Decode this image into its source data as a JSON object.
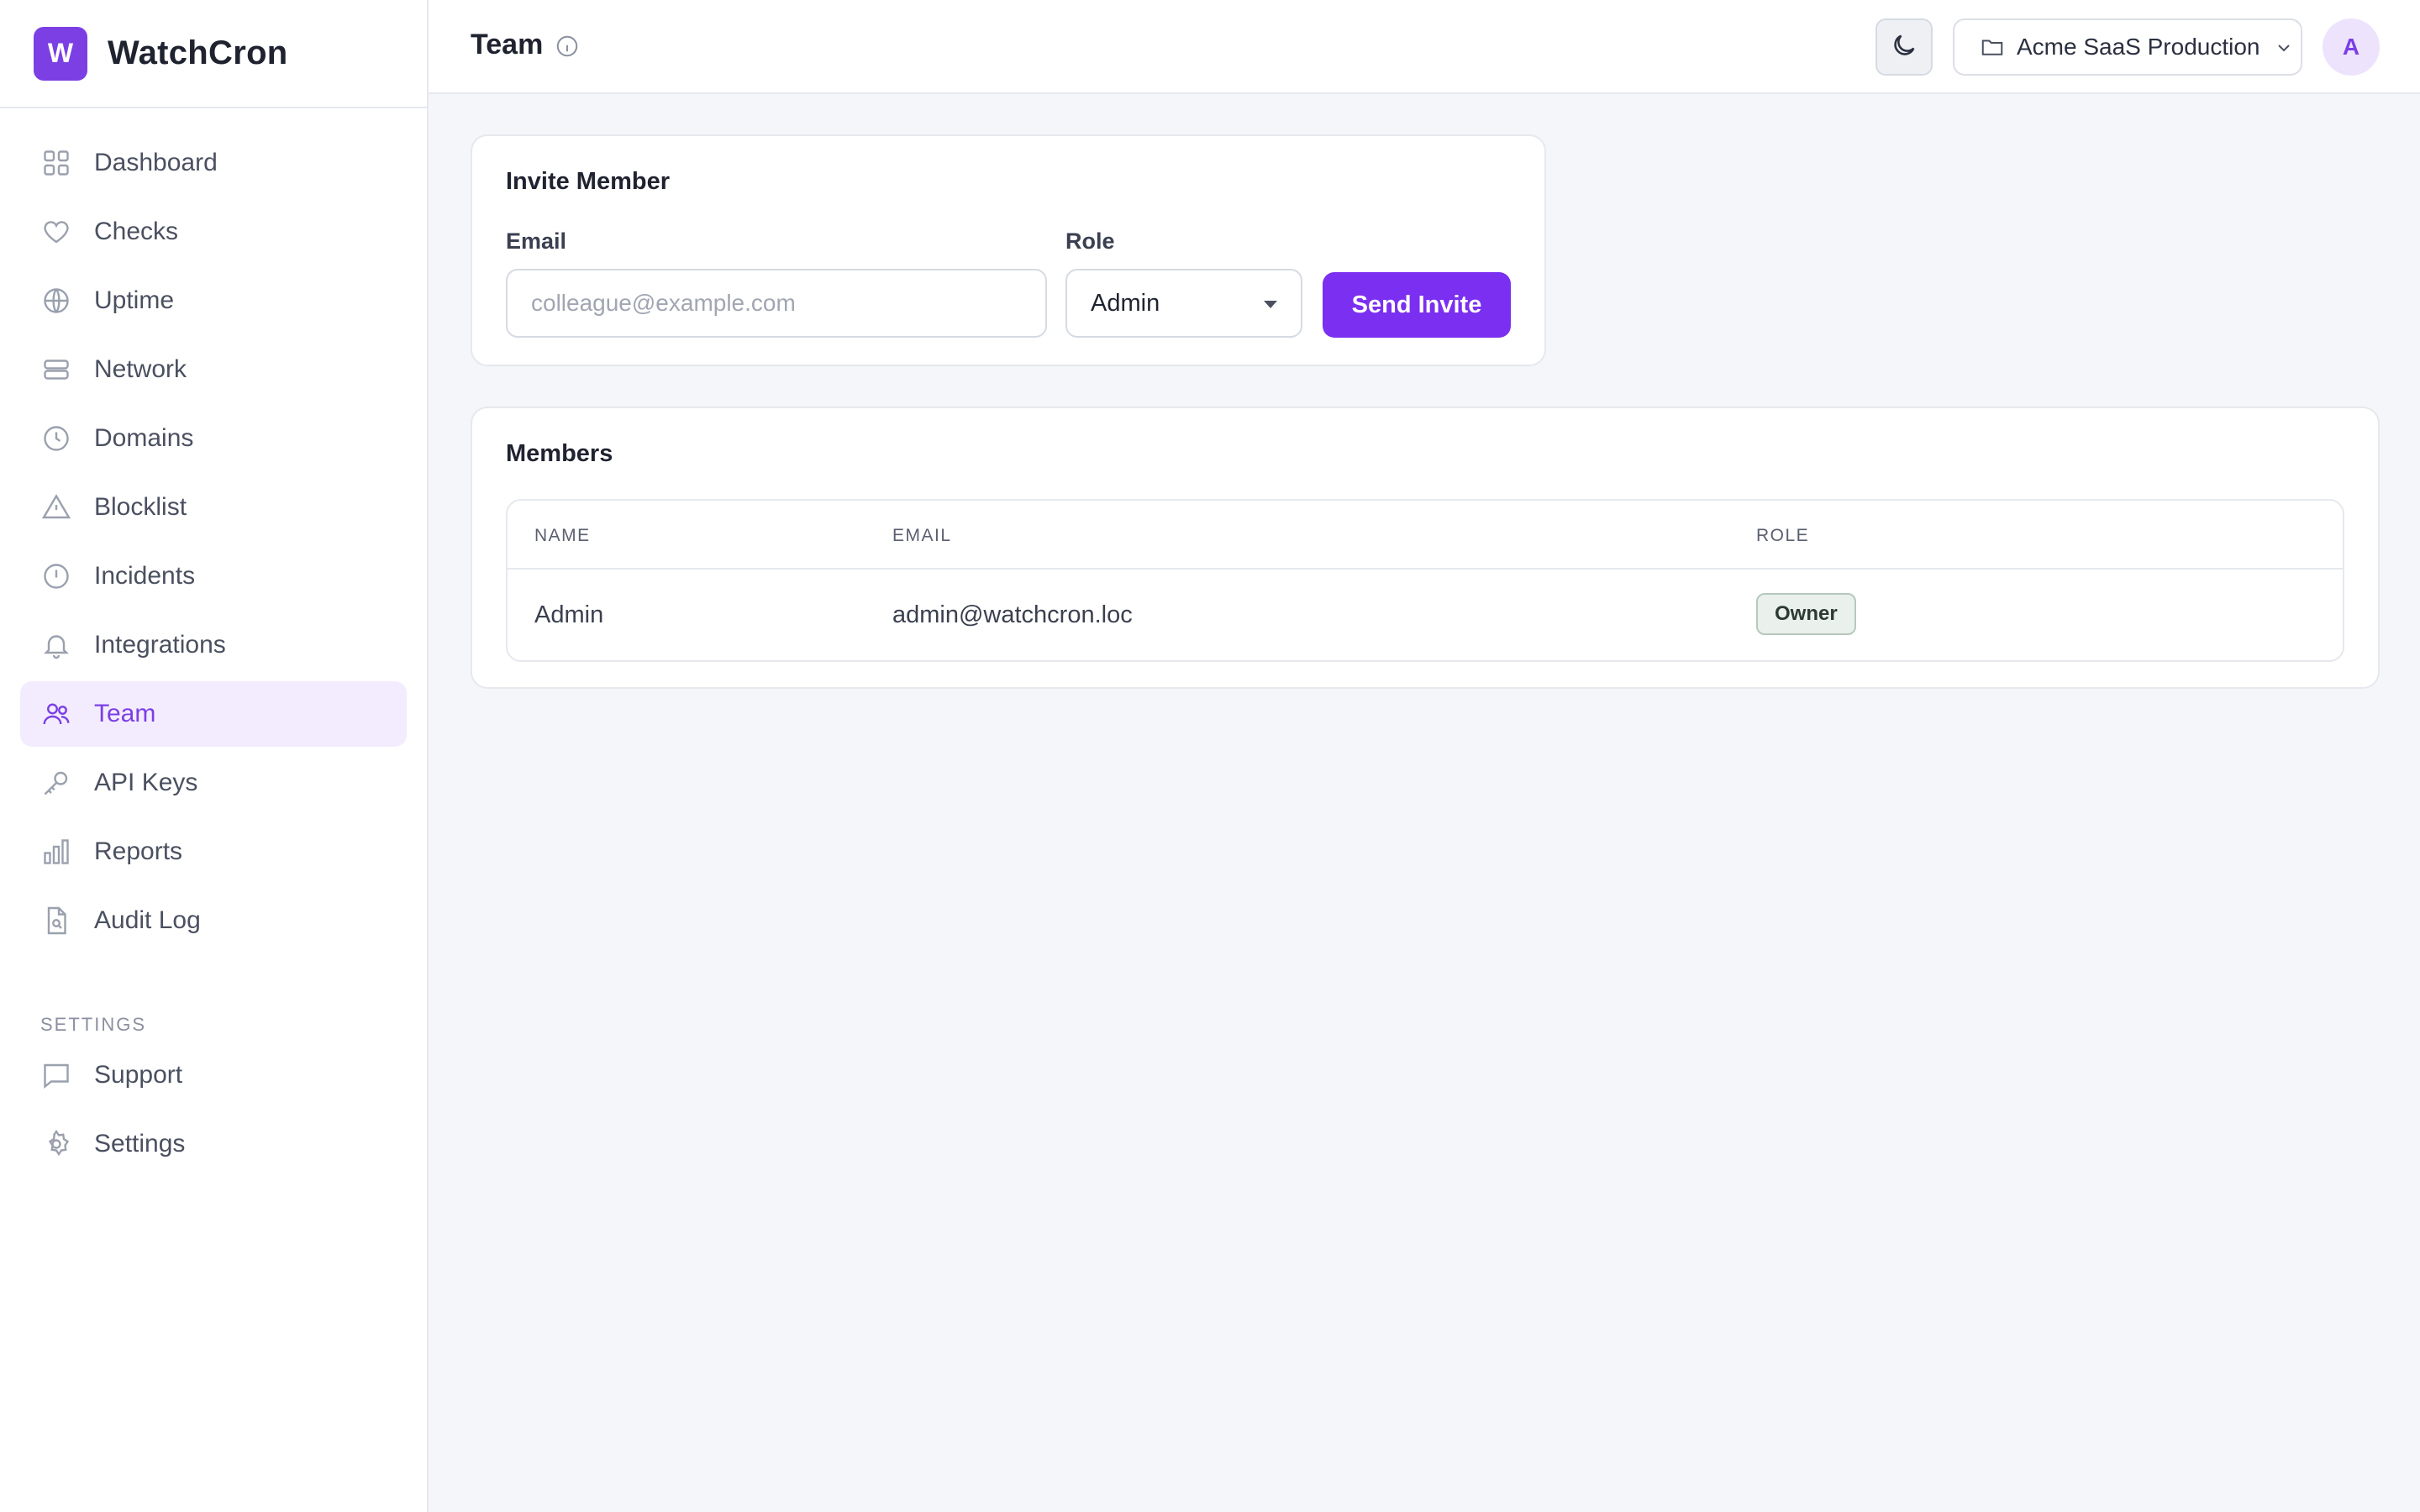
{
  "app": {
    "logo_letter": "W",
    "name": "WatchCron"
  },
  "sidebar": {
    "items": [
      {
        "label": "Dashboard",
        "icon": "grid-icon"
      },
      {
        "label": "Checks",
        "icon": "heart-icon"
      },
      {
        "label": "Uptime",
        "icon": "globe-icon"
      },
      {
        "label": "Network",
        "icon": "server-icon"
      },
      {
        "label": "Domains",
        "icon": "clock-icon"
      },
      {
        "label": "Blocklist",
        "icon": "warning-icon"
      },
      {
        "label": "Incidents",
        "icon": "alert-circle-icon"
      },
      {
        "label": "Integrations",
        "icon": "bell-icon"
      },
      {
        "label": "Team",
        "icon": "users-icon",
        "active": true
      },
      {
        "label": "API Keys",
        "icon": "key-icon"
      },
      {
        "label": "Reports",
        "icon": "bar-chart-icon"
      },
      {
        "label": "Audit Log",
        "icon": "file-search-icon"
      }
    ],
    "section_label": "SETTINGS",
    "settings_items": [
      {
        "label": "Support",
        "icon": "message-icon"
      },
      {
        "label": "Settings",
        "icon": "gear-icon"
      }
    ]
  },
  "header": {
    "title": "Team",
    "project": "Acme SaaS Production",
    "avatar_letter": "A"
  },
  "invite": {
    "title": "Invite Member",
    "email_label": "Email",
    "email_placeholder": "colleague@example.com",
    "email_value": "",
    "role_label": "Role",
    "role_value": "Admin",
    "send_label": "Send Invite"
  },
  "members": {
    "title": "Members",
    "columns": [
      "NAME",
      "EMAIL",
      "ROLE"
    ],
    "rows": [
      {
        "name": "Admin",
        "email": "admin@watchcron.loc",
        "role": "Owner"
      }
    ]
  },
  "colors": {
    "accent": "#7b2ff0",
    "active_bg": "#f3ecfe",
    "badge_bg": "#eaf0ec"
  }
}
